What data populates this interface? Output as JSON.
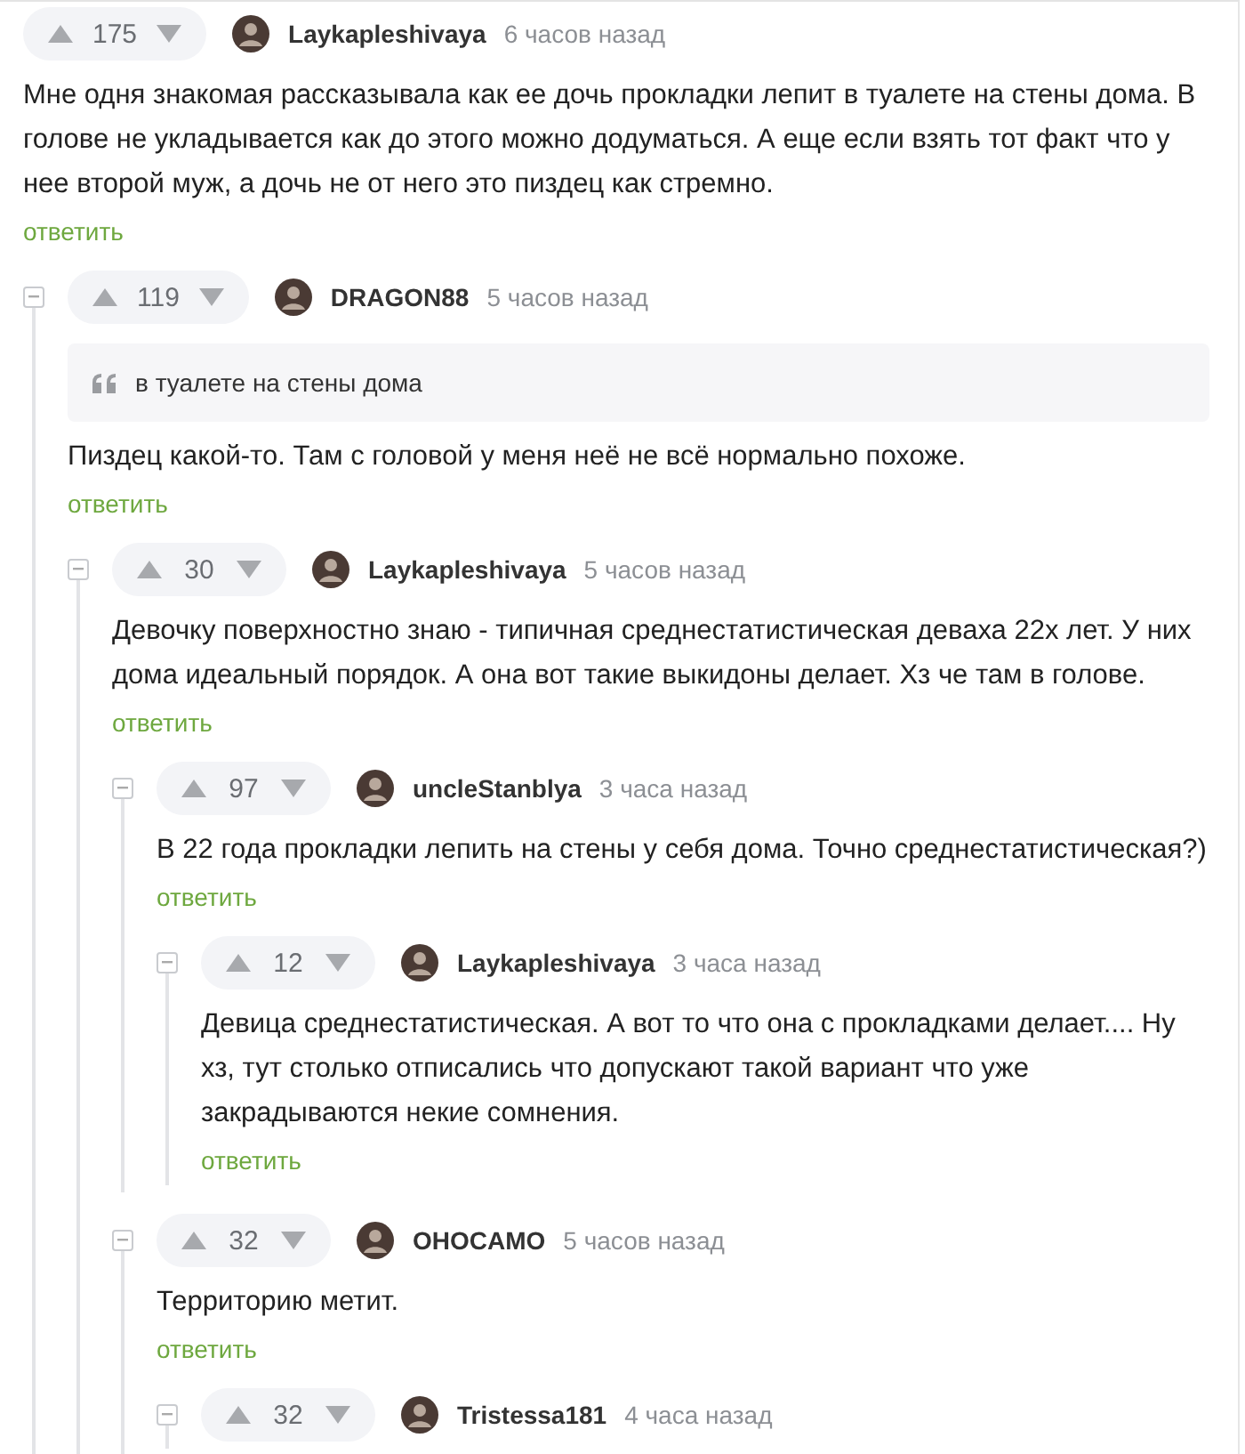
{
  "comments": [
    {
      "votes": "175",
      "author": "Laykapleshivaya",
      "time": "6 часов назад",
      "text": "Мне одня знакомая рассказывала как ее дочь прокладки лепит в туалете на стены дома. В голове не укладывается как до этого можно додуматься. А еще если взять тот факт что у нее второй муж, а дочь не от него это пиздец как стремно.",
      "reply": "ответить",
      "children": [
        {
          "votes": "119",
          "author": "DRAGON88",
          "time": "5 часов назад",
          "quote": "в туалете на стены дома",
          "text": "Пиздец какой-то. Там с головой у меня неё не всё нормально похоже.",
          "reply": "ответить",
          "children": [
            {
              "votes": "30",
              "author": "Laykapleshivaya",
              "time": "5 часов назад",
              "text": "Девочку поверхностно знаю - типичная среднестатистическая деваха 22х лет. У них дома идеальный порядок. А она вот такие выкидоны делает. Хз че там в голове.",
              "reply": "ответить",
              "children": [
                {
                  "votes": "97",
                  "author": "uncleStanblya",
                  "time": "3 часа назад",
                  "text": "В 22 года прокладки лепить на стены у себя дома. Точно среднестатистическая?)",
                  "reply": "ответить",
                  "children": [
                    {
                      "votes": "12",
                      "author": "Laykapleshivaya",
                      "time": "3 часа назад",
                      "text": "Девица среднестатистическая. А вот то что она с прокладками делает.... Ну хз, тут столько отписались что допускают такой вариант что уже закрадываются некие сомнения.",
                      "reply": "ответить"
                    }
                  ]
                },
                {
                  "votes": "32",
                  "author": "OHOCAMO",
                  "time": "5 часов назад",
                  "text": "Территорию метит.",
                  "reply": "ответить",
                  "children": [
                    {
                      "votes": "32",
                      "author": "Tristessa181",
                      "time": "4 часа назад"
                    }
                  ]
                }
              ]
            }
          ]
        }
      ]
    }
  ]
}
